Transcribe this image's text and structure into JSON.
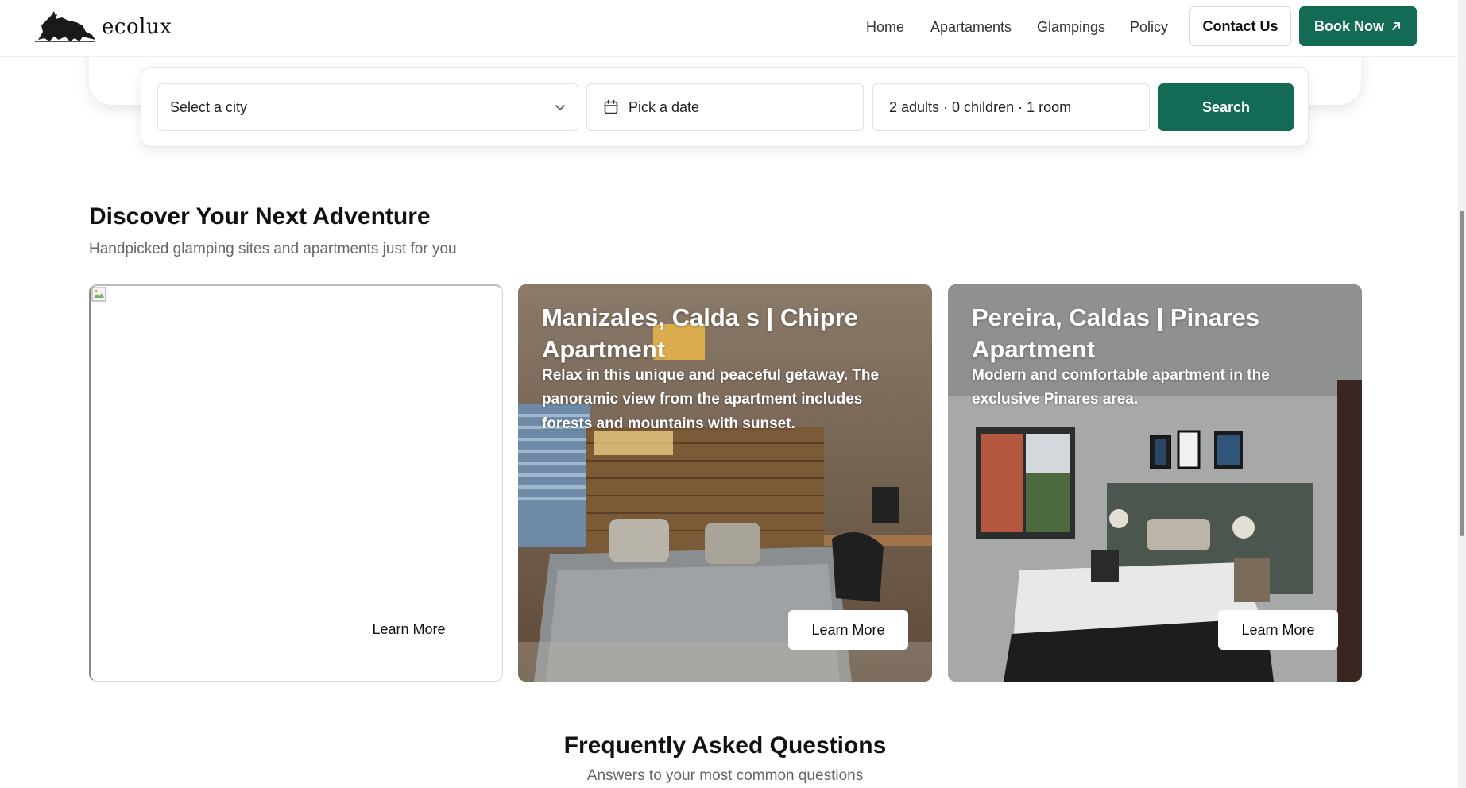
{
  "header": {
    "brand": "ecolux",
    "nav": [
      {
        "label": "Home"
      },
      {
        "label": "Apartaments"
      },
      {
        "label": "Glampings"
      },
      {
        "label": "Policy"
      }
    ],
    "contact_label": "Contact Us",
    "book_label": "Book Now"
  },
  "search": {
    "city_placeholder": "Select a city",
    "date_placeholder": "Pick a date",
    "guests_value": "2 adults · 0 children · 1 room",
    "button_label": "Search"
  },
  "discover": {
    "title": "Discover Your Next Adventure",
    "subtitle": "Handpicked glamping sites and apartments just for you"
  },
  "cards": [
    {
      "title": "",
      "description": "",
      "button_label": "Learn More"
    },
    {
      "title": "Manizales, Calda s | Chipre Apartment",
      "description": "Relax in this unique and peaceful getaway. The panoramic view from the apartment includes forests and mountains with sunset.",
      "button_label": "Learn More"
    },
    {
      "title": "Pereira, Caldas | Pinares Apartment",
      "description": "Modern and comfortable apartment in the exclusive Pinares area.",
      "button_label": "Learn More"
    }
  ],
  "faq": {
    "title": "Frequently Asked Questions",
    "subtitle": "Answers to your most common questions"
  },
  "colors": {
    "brand_green": "#136b55"
  },
  "icons": {
    "logo": "panther-logo-icon",
    "external": "arrow-up-right-icon",
    "city_select": "chevron-down-icon",
    "date": "calendar-icon"
  }
}
